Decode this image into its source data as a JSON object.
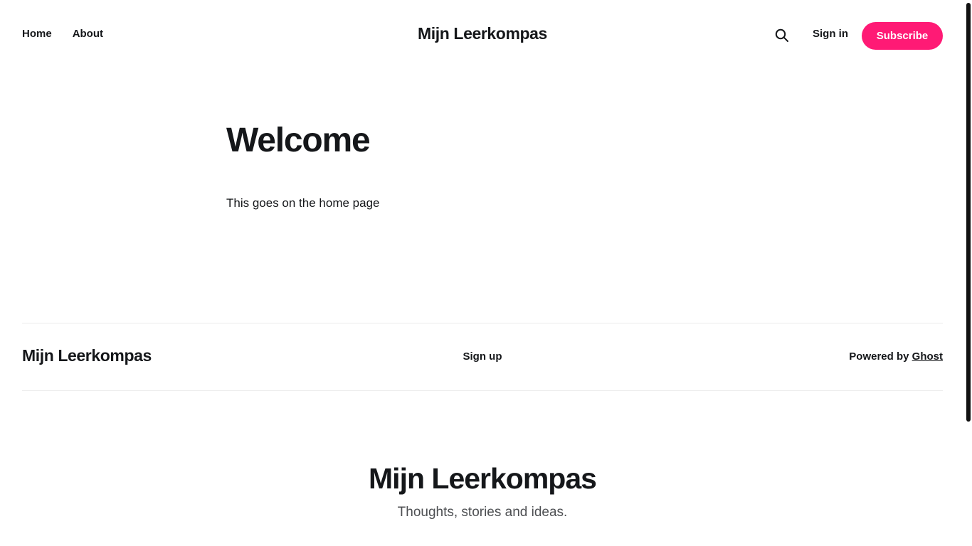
{
  "header": {
    "nav": [
      {
        "label": "Home"
      },
      {
        "label": "About"
      }
    ],
    "site_title": "Mijn Leerkompas",
    "search_icon": "search-icon",
    "sign_in_label": "Sign in",
    "subscribe_label": "Subscribe"
  },
  "main": {
    "title": "Welcome",
    "body": "This goes on the home page"
  },
  "footer": {
    "site_title": "Mijn Leerkompas",
    "signup_label": "Sign up",
    "powered_by_prefix": "Powered by",
    "powered_by_link": "Ghost"
  },
  "hero": {
    "title": "Mijn Leerkompas",
    "tagline": "Thoughts, stories and ideas."
  },
  "colors": {
    "accent": "#ff1a75",
    "text": "#15171a",
    "muted": "#4d4f52",
    "divider": "#ececec"
  }
}
